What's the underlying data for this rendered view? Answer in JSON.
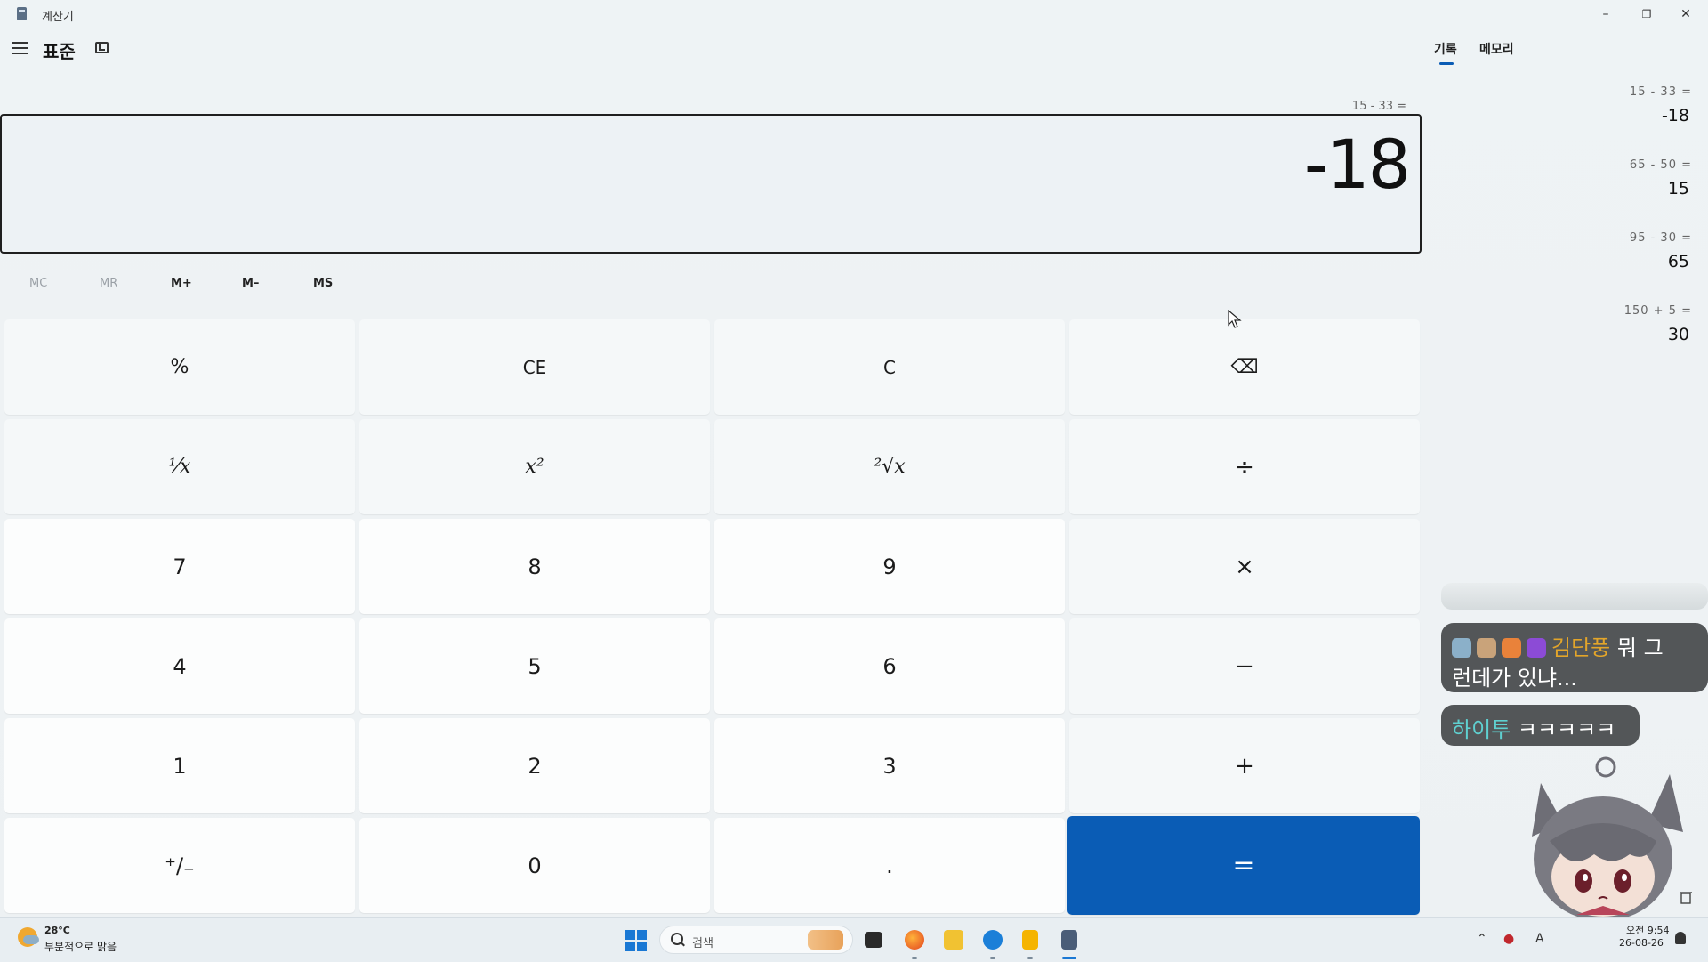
{
  "window": {
    "title": "계산기",
    "minimize": "–",
    "maximize": "❐",
    "close": "✕"
  },
  "header": {
    "mode": "표준"
  },
  "display": {
    "expression": "15 - 33 =",
    "result": "-18"
  },
  "memory": {
    "mc": "MC",
    "mr": "MR",
    "mplus": "M+",
    "mminus": "M–",
    "ms": "MS"
  },
  "keys": {
    "percent": "%",
    "ce": "CE",
    "c": "C",
    "backspace": "⌫",
    "reciprocal": "¹⁄x",
    "square": "x²",
    "sqrt": "²√x",
    "divide": "÷",
    "k7": "7",
    "k8": "8",
    "k9": "9",
    "multiply": "×",
    "k4": "4",
    "k5": "5",
    "k6": "6",
    "minus": "−",
    "k1": "1",
    "k2": "2",
    "k3": "3",
    "plus": "+",
    "negate": "⁺∕₋",
    "k0": "0",
    "decimal": ".",
    "equals": "="
  },
  "panel": {
    "tabs": [
      "기록",
      "메모리"
    ],
    "history": [
      {
        "expr": "15  -  33 =",
        "result": "-18"
      },
      {
        "expr": "65  -  50 =",
        "result": "15"
      },
      {
        "expr": "95  -  30 =",
        "result": "65"
      },
      {
        "expr": "150  +  5 =",
        "result": "30"
      }
    ]
  },
  "chat": [
    {
      "name": "김단풍",
      "text": " 뭐 그",
      "text2": "런데가 있냐..."
    },
    {
      "name": "하이투",
      "text": " ㅋㅋㅋㅋㅋ"
    }
  ],
  "taskbar": {
    "weather_temp": "28°C",
    "weather_desc": "부분적으로 맑음",
    "search_placeholder": "검색",
    "clock_time": "오전 9:54",
    "clock_date": "26-08-26"
  },
  "colors": {
    "accent": "#0a5cb5",
    "equals_text": "#ffffff"
  }
}
